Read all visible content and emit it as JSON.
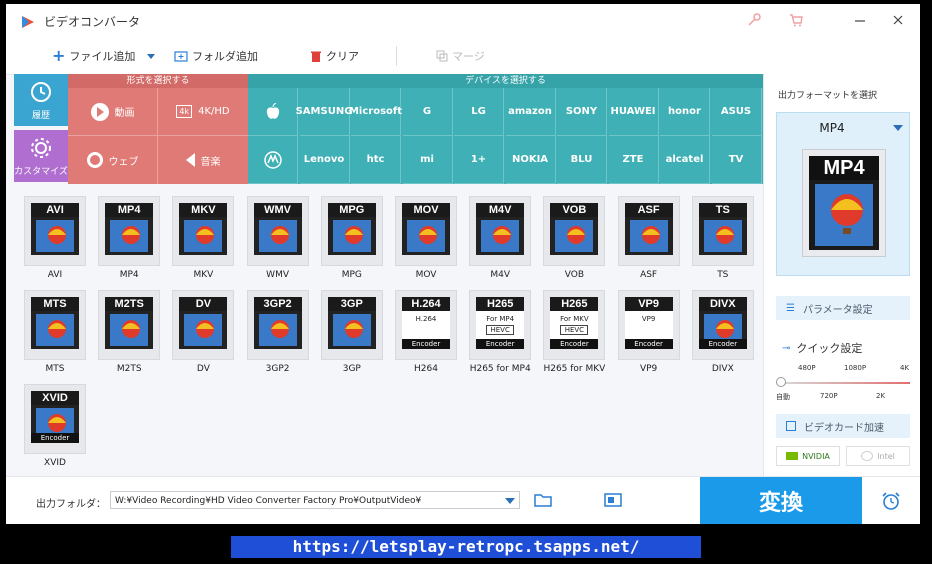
{
  "app": {
    "title": "ビデオコンバータ"
  },
  "toolbar": {
    "add_file": "ファイル追加",
    "add_folder": "フォルダ追加",
    "clear": "クリア",
    "merge": "マージ"
  },
  "sidebar": {
    "history": "履歴",
    "customize": "カスタマイズ"
  },
  "categories": {
    "format_header": "形式を選択する",
    "device_header": "デバイスを選択する",
    "format_items": [
      {
        "label": "動画",
        "icon": "play-icon"
      },
      {
        "label": "4K/HD",
        "icon": "4k-icon"
      },
      {
        "label": "ウェブ",
        "icon": "chrome-icon"
      },
      {
        "label": "音楽",
        "icon": "speaker-icon"
      }
    ],
    "devices_row1": [
      "",
      "SAMSUNG",
      "Microsoft",
      "G",
      "LG",
      "amazon",
      "SONY",
      "HUAWEI",
      "honor",
      "ASUS"
    ],
    "devices_row2": [
      "",
      "Lenovo",
      "htc",
      "mi",
      "1+",
      "NOKIA",
      "BLU",
      "ZTE",
      "alcatel",
      "TV"
    ],
    "colors": {
      "history": "#3aa5d0",
      "customize": "#b06fd0",
      "format": "#e07a76",
      "device": "#3fb0b5"
    }
  },
  "formats": [
    {
      "tile": "AVI",
      "label": "AVI"
    },
    {
      "tile": "MP4",
      "label": "MP4"
    },
    {
      "tile": "MKV",
      "label": "MKV"
    },
    {
      "tile": "WMV",
      "label": "WMV"
    },
    {
      "tile": "MPG",
      "label": "MPG"
    },
    {
      "tile": "MOV",
      "label": "MOV"
    },
    {
      "tile": "M4V",
      "label": "M4V"
    },
    {
      "tile": "VOB",
      "label": "VOB"
    },
    {
      "tile": "ASF",
      "label": "ASF"
    },
    {
      "tile": "TS",
      "label": "TS"
    },
    {
      "tile": "MTS",
      "label": "MTS"
    },
    {
      "tile": "M2TS",
      "label": "M2TS"
    },
    {
      "tile": "DV",
      "label": "DV"
    },
    {
      "tile": "3GP2",
      "label": "3GP2"
    },
    {
      "tile": "3GP",
      "label": "3GP"
    },
    {
      "tile": "H.264",
      "label": "H264",
      "sub": "H.264",
      "enc": "Encoder"
    },
    {
      "tile": "H265",
      "label": "H265 for MP4",
      "sub": "For MP4",
      "sub2": "HEVC",
      "enc": "Encoder"
    },
    {
      "tile": "H265",
      "label": "H265 for MKV",
      "sub": "For MKV",
      "sub2": "HEVC",
      "enc": "Encoder"
    },
    {
      "tile": "VP9",
      "label": "VP9",
      "sub": "VP9",
      "enc": "Encoder"
    },
    {
      "tile": "DIVX",
      "label": "DIVX",
      "enc": "Encoder"
    },
    {
      "tile": "XVID",
      "label": "XVID",
      "enc": "Encoder"
    }
  ],
  "output": {
    "label": "出力フォルダ：",
    "path": "W:¥Video Recording¥HD Video Converter Factory Pro¥OutputVideo¥",
    "convert": "変換"
  },
  "right_panel": {
    "title": "出力フォーマットを選択",
    "selected_format": "MP4",
    "tile_caption": "MP4",
    "param_button": "パラメータ設定",
    "quick_title": "クイック設定",
    "quality_top": [
      "480P",
      "1080P",
      "4K"
    ],
    "quality_bottom": [
      "自動",
      "720P",
      "2K"
    ],
    "gpu_button": "ビデオカード加速",
    "nvidia": "NVIDIA",
    "intel": "Intel"
  },
  "watermark": "https://letsplay-retropc.tsapps.net/"
}
